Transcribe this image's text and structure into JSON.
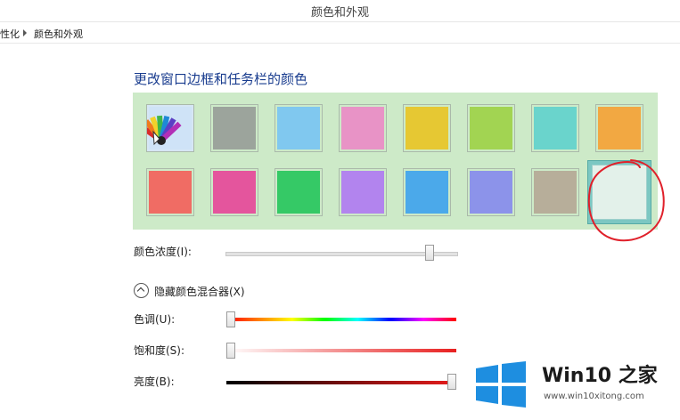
{
  "window": {
    "title": "颜色和外观"
  },
  "breadcrumb": {
    "parent": "性化",
    "current": "颜色和外观"
  },
  "heading": "更改窗口边框和任务栏的颜色",
  "palette": {
    "background": "#cdeac8",
    "colors": [
      "#9ca49c",
      "#80c8ef",
      "#e893c6",
      "#e6c833",
      "#a2d452",
      "#6ad4cc",
      "#f2a842",
      "#f06c64",
      "#e4559d",
      "#35c966",
      "#b284ee",
      "#4ba9ea",
      "#8c93ea",
      "#b7ae9a",
      "#e3f1ea"
    ],
    "custom_icon": "color-wheel-icon",
    "selected_index": 14
  },
  "intensity": {
    "label": "颜色浓度(I):",
    "value": 0.9
  },
  "mixer_toggle": {
    "label": "隐藏颜色混合器(X)"
  },
  "hue": {
    "label": "色调(U):",
    "value": 0.0
  },
  "saturation": {
    "label": "饱和度(S):",
    "value": 0.0
  },
  "brightness": {
    "label": "亮度(B):",
    "value": 1.0
  },
  "watermark": {
    "brand": "Win10 之家",
    "url": "www.win10xitong.com"
  },
  "annotation": {
    "color": "#e0202a"
  }
}
